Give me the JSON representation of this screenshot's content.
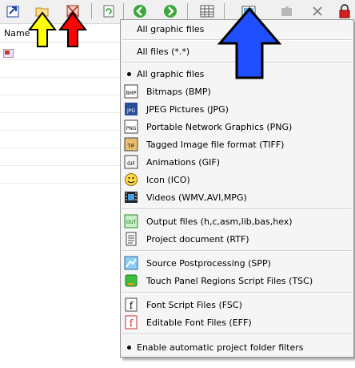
{
  "toolbar": {
    "icons": [
      "export-icon",
      "open-folder-icon",
      "close-project-icon",
      "refresh-icon",
      "back-icon",
      "forward-icon",
      "table-view-icon",
      "picture-filter-icon",
      "puzzle-icon",
      "delete-icon",
      "lock-icon"
    ]
  },
  "left_pane": {
    "column_header": "Name"
  },
  "menu": {
    "item_all_graphic_top": "All graphic files",
    "item_all_files": "All files (*.*)",
    "item_all_graphic_checked": "All graphic files",
    "item_bmp": "Bitmaps (BMP)",
    "item_jpg": "JPEG Pictures (JPG)",
    "item_png": "Portable Network Graphics (PNG)",
    "item_tiff": "Tagged Image file format (TIFF)",
    "item_gif": "Animations (GIF)",
    "item_ico": "Icon (ICO)",
    "item_videos": "Videos (WMV,AVI,MPG)",
    "item_output": "Output files (h,c,asm,lib,bas,hex)",
    "item_rtf": "Project document (RTF)",
    "item_spp": "Source Postprocessing (SPP)",
    "item_tsc": "Touch Panel Regions Script Files (TSC)",
    "item_fsc": "Font Script Files  (FSC)",
    "item_eff": "Editable Font Files (EFF)",
    "item_auto_filters": "Enable automatic project folder filters",
    "icon_text": {
      "bmp": "BMP",
      "jpg": "JPG",
      "png": "PNG",
      "tif": "TIF",
      "gif": "GIF",
      "out": "OUT",
      "f": "f"
    }
  },
  "colors": {
    "yellow_arrow": "#ffff00",
    "red_arrow": "#ff0000",
    "blue_arrow": "#1f4fff",
    "menu_bg": "#f5f5f5"
  }
}
